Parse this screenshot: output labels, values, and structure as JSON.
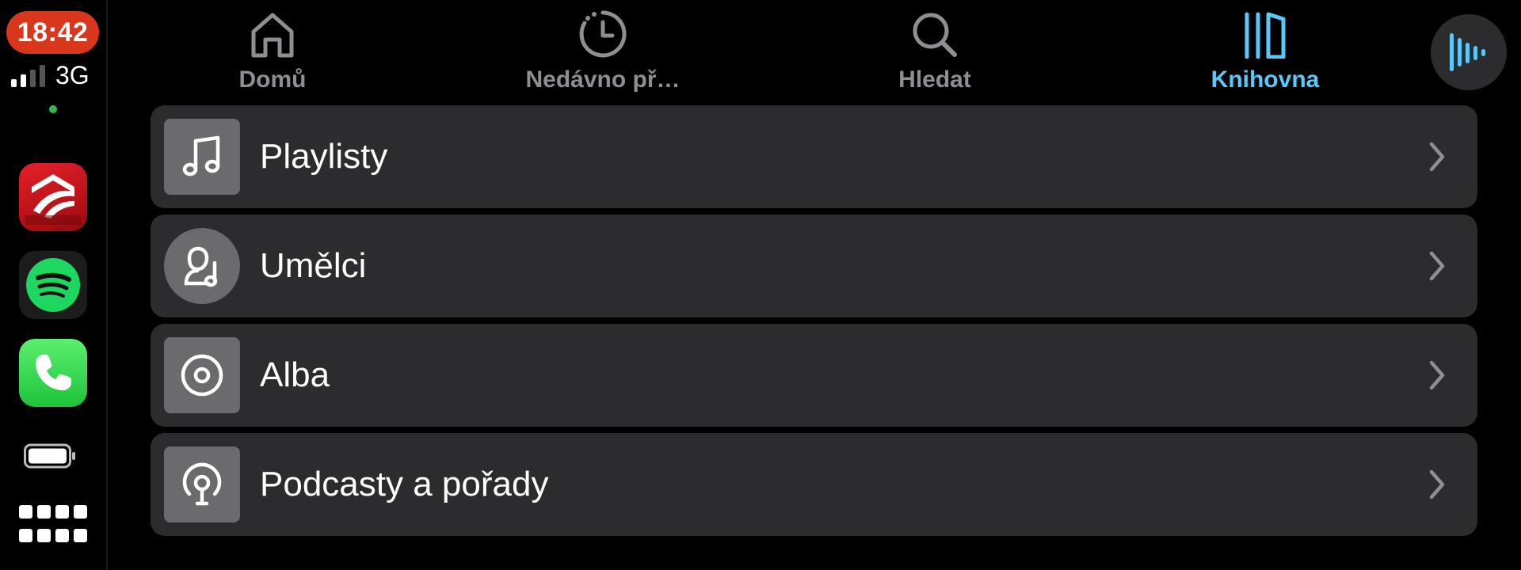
{
  "status": {
    "time": "18:42",
    "network": "3G",
    "signal_bars_filled": 2,
    "signal_bars_total": 4
  },
  "dock_apps": [
    {
      "name": "t-lux-app",
      "icon": "road-logo-icon"
    },
    {
      "name": "spotify-app",
      "icon": "spotify-icon"
    },
    {
      "name": "phone-app",
      "icon": "phone-icon"
    }
  ],
  "tabs": [
    {
      "id": "home",
      "label": "Domů",
      "icon": "home-icon",
      "active": false
    },
    {
      "id": "recent",
      "label": "Nedávno př…",
      "icon": "clock-history-icon",
      "active": false
    },
    {
      "id": "search",
      "label": "Hledat",
      "icon": "search-icon",
      "active": false
    },
    {
      "id": "library",
      "label": "Knihovna",
      "icon": "library-icon",
      "active": true
    }
  ],
  "library_items": [
    {
      "label": "Playlisty",
      "icon": "music-note-icon"
    },
    {
      "label": "Umělci",
      "icon": "artist-icon"
    },
    {
      "label": "Alba",
      "icon": "album-icon"
    },
    {
      "label": "Podcasty a pořady",
      "icon": "podcast-icon"
    }
  ],
  "colors": {
    "accent": "#5ac8fa",
    "tab_inactive": "#8e8e93",
    "row_background": "#2c2c2e",
    "clock_badge": "#d9371c",
    "spotify_green": "#1ed760",
    "phone_green": "#34c759"
  }
}
